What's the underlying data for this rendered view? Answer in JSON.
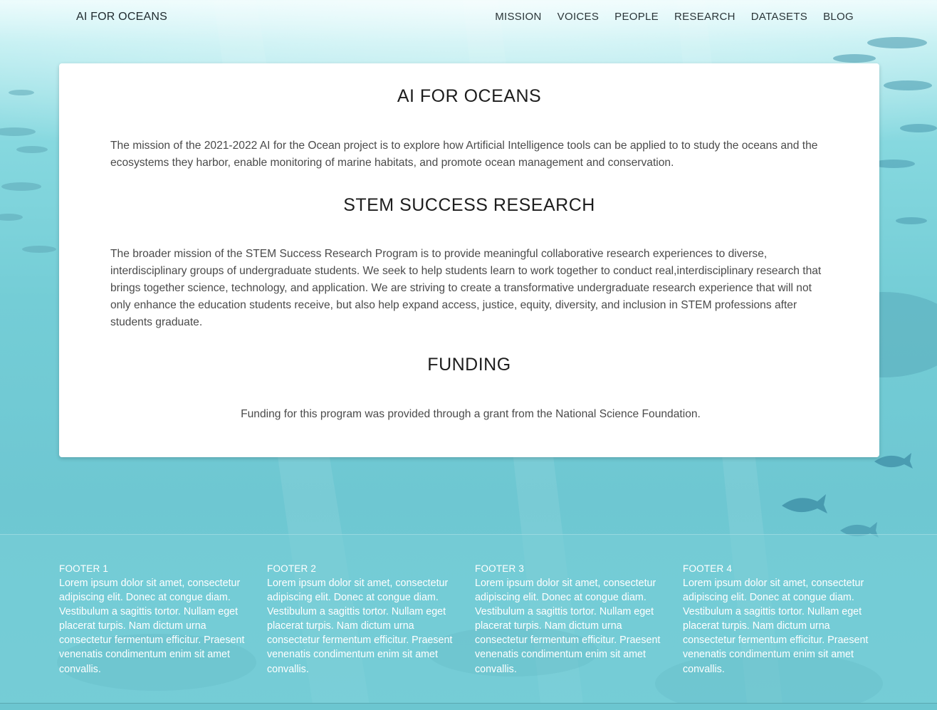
{
  "header": {
    "brand": "AI FOR OCEANS",
    "nav": [
      "MISSION",
      "VOICES",
      "PEOPLE",
      "RESEARCH",
      "DATASETS",
      "BLOG"
    ]
  },
  "sections": [
    {
      "title": "AI FOR OCEANS",
      "text": "The mission of the 2021-2022 AI for the Ocean project is to explore how Artificial Intelligence tools can be applied to to study the oceans and the ecosystems they harbor, enable monitoring of marine habitats, and promote ocean management and conservation."
    },
    {
      "title": "STEM SUCCESS RESEARCH",
      "text": "The broader mission of the STEM Success Research Program is to provide meaningful collaborative research experiences to diverse, interdisciplinary groups of undergraduate students. We seek to help students learn to work together to conduct real,interdisciplinary research that brings together science, technology, and application. We are striving to create a transformative undergraduate research experience that will not only enhance the education students receive, but also help expand access, justice, equity, diversity, and inclusion in STEM professions after students graduate."
    },
    {
      "title": "FUNDING",
      "text": "Funding for this program was provided through a grant from the National Science Foundation."
    }
  ],
  "footer": [
    {
      "title": "FOOTER 1",
      "text": "Lorem ipsum dolor sit amet, consectetur adipiscing elit. Donec at congue diam. Vestibulum a sagittis tortor. Nullam eget placerat turpis. Nam dictum urna consectetur fermentum efficitur. Praesent venenatis condimentum enim sit amet convallis."
    },
    {
      "title": "FOOTER 2",
      "text": "Lorem ipsum dolor sit amet, consectetur adipiscing elit. Donec at congue diam. Vestibulum a sagittis tortor. Nullam eget placerat turpis. Nam dictum urna consectetur fermentum efficitur. Praesent venenatis condimentum enim sit amet convallis."
    },
    {
      "title": "FOOTER 3",
      "text": "Lorem ipsum dolor sit amet, consectetur adipiscing elit. Donec at congue diam. Vestibulum a sagittis tortor. Nullam eget placerat turpis. Nam dictum urna consectetur fermentum efficitur. Praesent venenatis condimentum enim sit amet convallis."
    },
    {
      "title": "FOOTER 4",
      "text": "Lorem ipsum dolor sit amet, consectetur adipiscing elit. Donec at congue diam. Vestibulum a sagittis tortor. Nullam eget placerat turpis. Nam dictum urna consectetur fermentum efficitur. Praesent venenatis condimentum enim sit amet convallis."
    }
  ],
  "colors": {
    "background": "#74cdd6",
    "card": "#ffffff",
    "heading": "#1d1d1d",
    "body_text": "#4a4a4a",
    "footer_text": "#ffffff"
  },
  "icons": {
    "fish": "fish-icon"
  }
}
